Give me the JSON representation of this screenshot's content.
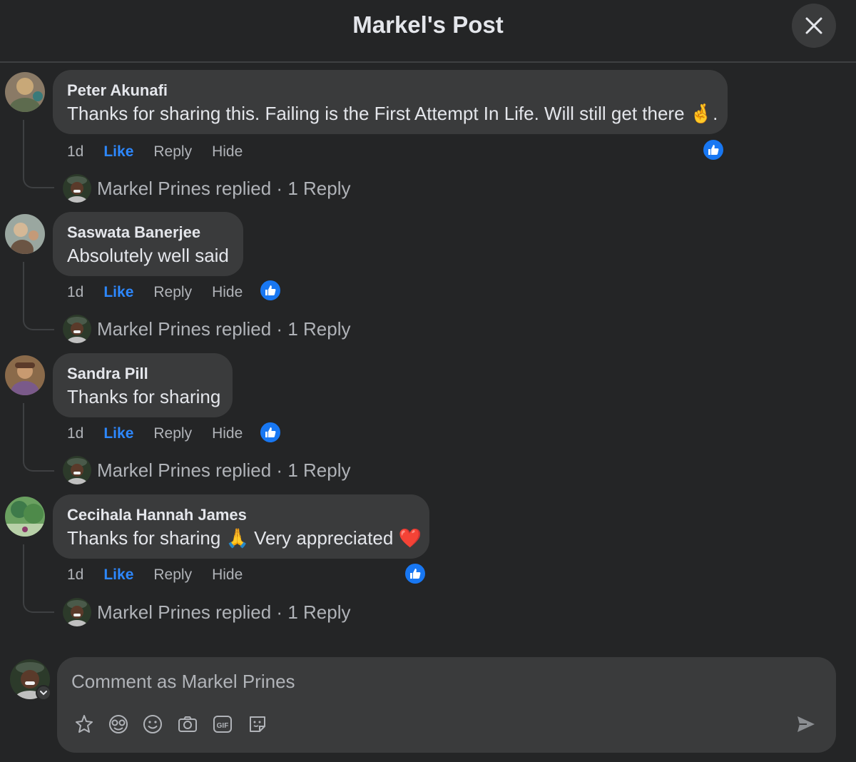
{
  "header": {
    "title": "Markel's Post"
  },
  "comments": [
    {
      "author": "Peter Akunafi",
      "text": "Thanks for sharing this. Failing is the First Attempt In Life. Will still get there 🤞.",
      "time": "1d",
      "like": "Like",
      "reply": "Reply",
      "hide": "Hide",
      "replies": "Markel Prines replied · 1 Reply",
      "avatar_colors": [
        "#8a7a66",
        "#5d6b4e",
        "#c8a878"
      ]
    },
    {
      "author": "Saswata Banerjee",
      "text": "Absolutely well said",
      "time": "1d",
      "like": "Like",
      "reply": "Reply",
      "hide": "Hide",
      "replies": "Markel Prines replied · 1 Reply",
      "avatar_colors": [
        "#9aa7a0",
        "#6b5544",
        "#d4b896"
      ]
    },
    {
      "author": "Sandra Pill",
      "text": "Thanks for sharing",
      "time": "1d",
      "like": "Like",
      "reply": "Reply",
      "hide": "Hide",
      "replies": "Markel Prines replied · 1 Reply",
      "avatar_colors": [
        "#7a5a8a",
        "#c89a70",
        "#5a3a2a"
      ]
    },
    {
      "author": "Cecihala Hannah James",
      "text": "Thanks for sharing 🙏 Very appreciated ❤️",
      "time": "1d",
      "like": "Like",
      "reply": "Reply",
      "hide": "Hide",
      "replies": "Markel Prines replied · 1 Reply",
      "avatar_colors": [
        "#6aa060",
        "#3e7a4a",
        "#b8d0a8"
      ]
    }
  ],
  "composer": {
    "placeholder": "Comment as Markel Prines",
    "tools": [
      "avatar-sticker-icon",
      "emoji-faces-icon",
      "emoji-icon",
      "camera-icon",
      "gif-icon",
      "sticker-icon"
    ],
    "gif_label": "GIF"
  },
  "colors": {
    "accent": "#2d88ff",
    "background": "#242526",
    "bubble": "#3a3b3c"
  }
}
